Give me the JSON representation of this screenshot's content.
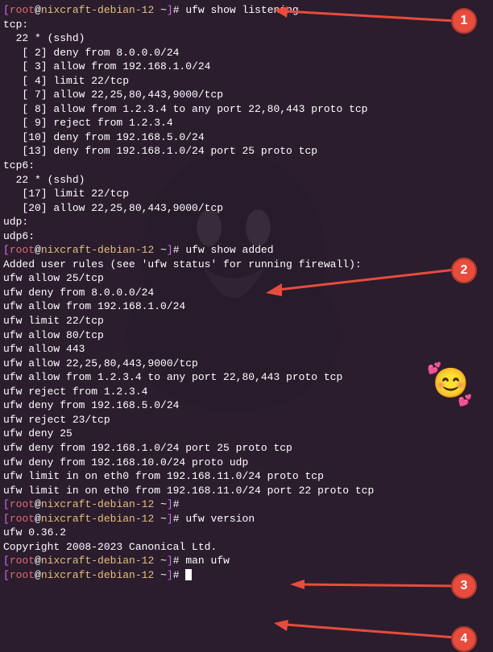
{
  "prompt": {
    "bracket_open": "[",
    "bracket_close": "]",
    "user": "root",
    "at": "@",
    "host": "nixcraft-debian-12",
    "path": " ~",
    "hash": "# "
  },
  "cmd1": "ufw show listening",
  "out1": {
    "l1": "tcp:",
    "l2": "  22 * (sshd)",
    "l3": "   [ 2] deny from 8.0.0.0/24",
    "l4": "   [ 3] allow from 192.168.1.0/24",
    "l5": "   [ 4] limit 22/tcp",
    "l6": "   [ 7] allow 22,25,80,443,9000/tcp",
    "l7": "   [ 8] allow from 1.2.3.4 to any port 22,80,443 proto tcp",
    "l8": "   [ 9] reject from 1.2.3.4",
    "l9": "   [10] deny from 192.168.5.0/24",
    "l10": "   [13] deny from 192.168.1.0/24 port 25 proto tcp",
    "l11": "",
    "l12": "tcp6:",
    "l13": "  22 * (sshd)",
    "l14": "   [17] limit 22/tcp",
    "l15": "   [20] allow 22,25,80,443,9000/tcp",
    "l16": "",
    "l17": "udp:",
    "l18": "udp6:"
  },
  "cmd2": "ufw show added",
  "out2": {
    "l1": "Added user rules (see 'ufw status' for running firewall):",
    "l2": "ufw allow 25/tcp",
    "l3": "ufw deny from 8.0.0.0/24",
    "l4": "ufw allow from 192.168.1.0/24",
    "l5": "ufw limit 22/tcp",
    "l6": "ufw allow 80/tcp",
    "l7": "ufw allow 443",
    "l8": "ufw allow 22,25,80,443,9000/tcp",
    "l9": "ufw allow from 1.2.3.4 to any port 22,80,443 proto tcp",
    "l10": "ufw reject from 1.2.3.4",
    "l11": "ufw deny from 192.168.5.0/24",
    "l12": "ufw reject 23/tcp",
    "l13": "ufw deny 25",
    "l14": "ufw deny from 192.168.1.0/24 port 25 proto tcp",
    "l15": "ufw deny from 192.168.10.0/24 proto udp",
    "l16": "ufw limit in on eth0 from 192.168.11.0/24 proto tcp",
    "l17": "ufw limit in on eth0 from 192.168.11.0/24 port 22 proto tcp",
    "l18": ""
  },
  "cmd_empty": "",
  "cmd3": "ufw version",
  "out3": {
    "l1": "ufw 0.36.2",
    "l2": "Copyright 2008-2023 Canonical Ltd."
  },
  "cmd4": "man ufw",
  "badges": {
    "b1": "1",
    "b2": "2",
    "b3": "3",
    "b4": "4"
  }
}
